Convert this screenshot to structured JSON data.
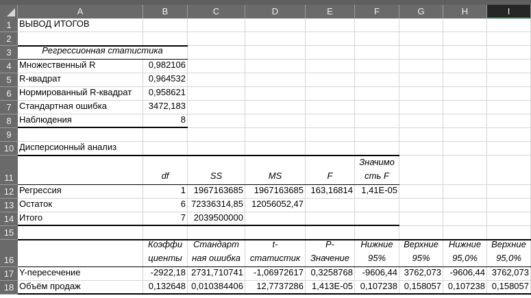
{
  "columns": [
    "A",
    "B",
    "C",
    "D",
    "E",
    "F",
    "G",
    "H",
    "I"
  ],
  "selected_column": "I",
  "rows": [
    {
      "n": "1",
      "cells": {
        "A": "ВЫВОД ИТОГОВ"
      }
    },
    {
      "n": "2",
      "cells": {}
    },
    {
      "n": "3",
      "cells": {
        "A": "Регрессионная статистика"
      }
    },
    {
      "n": "4",
      "cells": {
        "A": "Множественный R",
        "B": "0,982106"
      }
    },
    {
      "n": "5",
      "cells": {
        "A": "R-квадрат",
        "B": "0,964532"
      }
    },
    {
      "n": "6",
      "cells": {
        "A": "Нормированный R-квадрат",
        "B": "0,958621"
      }
    },
    {
      "n": "7",
      "cells": {
        "A": "Стандартная ошибка",
        "B": "3472,183"
      }
    },
    {
      "n": "8",
      "cells": {
        "A": "Наблюдения",
        "B": "8"
      }
    },
    {
      "n": "9",
      "cells": {}
    },
    {
      "n": "10",
      "cells": {
        "A": "Дисперсионный анализ"
      }
    },
    {
      "n": "11",
      "cells": {
        "B": "df",
        "C": "SS",
        "D": "MS",
        "E": "F",
        "F": "Значимо сть F"
      }
    },
    {
      "n": "12",
      "cells": {
        "A": "Регрессия",
        "B": "1",
        "C": "1967163685",
        "D": "1967163685",
        "E": "163,16814",
        "F": "1,41E-05"
      }
    },
    {
      "n": "13",
      "cells": {
        "A": "Остаток",
        "B": "6",
        "C": "72336314,85",
        "D": "12056052,47"
      }
    },
    {
      "n": "14",
      "cells": {
        "A": "Итого",
        "B": "7",
        "C": "2039500000"
      }
    },
    {
      "n": "15",
      "cells": {}
    },
    {
      "n": "16",
      "cells": {
        "B": "Коэффи циенты",
        "C": "Стандарт ная ошибка",
        "D": "t- статистик",
        "E": "P- Значение",
        "F": "Нижние 95%",
        "G": "Верхние 95%",
        "H": "Нижние 95,0%",
        "I": "Верхние 95,0%"
      }
    },
    {
      "n": "17",
      "cells": {
        "A": "Y-пересечение",
        "B": "-2922,18",
        "C": "2731,710741",
        "D": "-1,06972617",
        "E": "0,3258768",
        "F": "-9606,44",
        "G": "3762,073",
        "H": "-9606,44",
        "I": "3762,073"
      }
    },
    {
      "n": "18",
      "cells": {
        "A": "Объём продаж",
        "B": "0,132648",
        "C": "0,010384406",
        "D": "12,7737286",
        "E": "1,413E-05",
        "F": "0,107238",
        "G": "0,158057",
        "H": "0,107238",
        "I": "0,158057"
      }
    }
  ]
}
